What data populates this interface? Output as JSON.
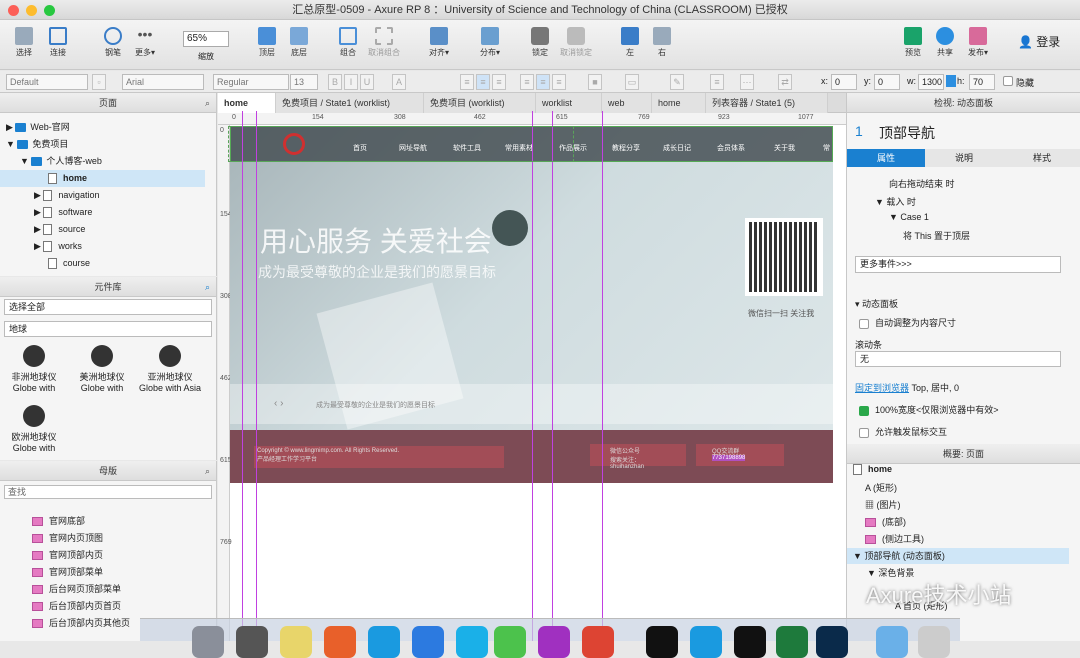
{
  "window": {
    "title": "汇总原型-0509 - Axure RP 8 ：University of Science and Technology of China (CLASSROOM) 已授权"
  },
  "toolbar": {
    "items": [
      {
        "label": "选择"
      },
      {
        "label": "连接"
      },
      {
        "label": "钢笔"
      },
      {
        "label": "更多▾"
      }
    ],
    "zoom": {
      "value": "65%",
      "label": "缩放"
    },
    "arrange": [
      {
        "label": "顶层"
      },
      {
        "label": "底层"
      },
      {
        "label": "组合"
      },
      {
        "label": "取消组合"
      },
      {
        "label": "对齐▾"
      },
      {
        "label": "分布▾"
      },
      {
        "label": "锁定"
      },
      {
        "label": "取消锁定"
      },
      {
        "label": "左"
      },
      {
        "label": "右"
      }
    ],
    "right": [
      {
        "label": "预览"
      },
      {
        "label": "共享"
      },
      {
        "label": "发布▾"
      }
    ],
    "login": "登录"
  },
  "format": {
    "style": "Default",
    "font": "Arial",
    "weight": "Regular",
    "size": "13",
    "x_label": "x:",
    "x": "0",
    "y_label": "y:",
    "y": "0",
    "w_label": "w:",
    "w": "1300",
    "h_label": "h:",
    "h": "70",
    "hide": "隐藏"
  },
  "pages": {
    "title": "页面",
    "items": [
      {
        "label": "Web-官网"
      },
      {
        "label": "免费项目"
      },
      {
        "label": "个人博客-web"
      },
      {
        "label": "home"
      },
      {
        "label": "navigation"
      },
      {
        "label": "software"
      },
      {
        "label": "source"
      },
      {
        "label": "works"
      },
      {
        "label": "course"
      }
    ]
  },
  "library": {
    "title": "元件库",
    "select": "选择全部",
    "search": "地球",
    "items": [
      {
        "line1": "非洲地球仪",
        "line2": "Globe with"
      },
      {
        "line1": "美洲地球仪",
        "line2": "Globe with"
      },
      {
        "line1": "亚洲地球仪",
        "line2": "Globe with Asia"
      },
      {
        "line1": "欧洲地球仪",
        "line2": "Globe with"
      }
    ]
  },
  "masters": {
    "title": "母版",
    "search_placeholder": "查找",
    "items": [
      {
        "label": "官网底部"
      },
      {
        "label": "官网内页顶图"
      },
      {
        "label": "官网顶部内页"
      },
      {
        "label": "官网顶部菜单"
      },
      {
        "label": "后台网页顶部菜单"
      },
      {
        "label": "后台顶部内页首页"
      },
      {
        "label": "后台顶部内页其他页"
      }
    ]
  },
  "tabs": [
    {
      "label": "home"
    },
    {
      "label": "免费项目 / State1 (worklist)"
    },
    {
      "label": "免费项目 (worklist)"
    },
    {
      "label": "worklist"
    },
    {
      "label": "web"
    },
    {
      "label": "home"
    },
    {
      "label": "列表容器 / State1 (5)"
    }
  ],
  "ruler": {
    "h": [
      "0",
      "154",
      "308",
      "462",
      "615",
      "769",
      "923",
      "1077"
    ],
    "v": [
      "0",
      "154",
      "308",
      "462",
      "615",
      "769"
    ]
  },
  "site": {
    "nav": [
      "首页",
      "网址导航",
      "软件工具",
      "常用素材",
      "作品展示",
      "教程分享",
      "成长日记",
      "会员体系",
      "关于我",
      "常"
    ],
    "headline": "用心服务 关爱社会",
    "subline": "成为最受尊敬的企业是我们的愿景目标",
    "qr_caption": "微信扫一扫  关注我",
    "carousel_text": "成为最受尊敬的企业是我们的愿景目标",
    "footer_copy": "Copyright © www.lingmimp.com. All Rights Reserved.",
    "footer_sub": "产品经理工作学习平台",
    "wechat_label": "微信公众号",
    "wechat_sub": "搜索关注：shuihanzhan",
    "qq_label": "QQ交流群",
    "qq_num": "7737198898"
  },
  "inspector": {
    "title": "检视: 动态面板",
    "index": "1",
    "name": "顶部导航",
    "tabs": [
      "属性",
      "说明",
      "样式"
    ],
    "events": [
      {
        "label": "向右拖动结束 时"
      },
      {
        "label": "载入 时"
      },
      {
        "label": "Case 1"
      },
      {
        "label": "将 This 置于顶层"
      }
    ],
    "more_events": "更多事件>>>",
    "section": "动态面板",
    "auto_fit": "自动调整为内容尺寸",
    "scrollbar_label": "滚动条",
    "scrollbar_value": "无",
    "pin_link": "固定到浏览器",
    "pin_value": "Top, 居中, 0",
    "width100": "100%宽度<仅限浏览器中有效>",
    "allow_touch": "允许触发鼠标交互"
  },
  "outline": {
    "title": "概要: 页面",
    "items": [
      {
        "label": "home"
      },
      {
        "label": "(矩形)"
      },
      {
        "label": "(图片)"
      },
      {
        "label": "(底部)"
      },
      {
        "label": "(侧边工具)"
      },
      {
        "label": "顶部导航 (动态面板)"
      },
      {
        "label": "深色背景"
      },
      {
        "label": "首页 (矩形)"
      }
    ]
  },
  "watermark": "Axure技术小站",
  "colors": {
    "accent": "#1a80d0",
    "guide": "#c040e0",
    "footer": "#7d4b55"
  }
}
